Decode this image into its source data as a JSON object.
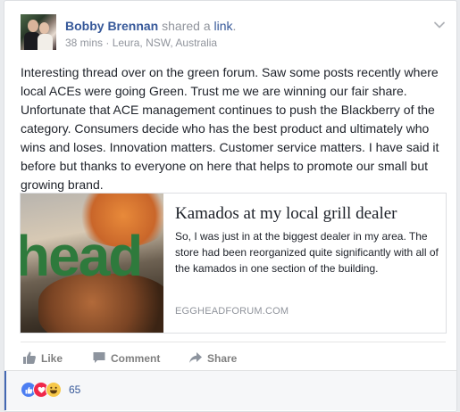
{
  "post": {
    "author": "Bobby Brennan",
    "action_text": " shared a ",
    "action_link": "link",
    "action_end": ".",
    "time": "38 mins",
    "separator": " · ",
    "location": "Leura, NSW, Australia",
    "body": "Interesting thread over on the green forum. Saw some posts recently where local ACEs were going Green. Trust me we are winning our fair share. Unfortunate that ACE management continues to push the Blackberry of the category. Consumers decide who has the best product and ultimately who wins and loses. Innovation matters. Customer service matters. I have said it before but thanks to everyone on here that helps to promote our small but growing brand."
  },
  "link_preview": {
    "image_text": "head",
    "title": "Kamados at my local grill dealer",
    "description": "So, I was just in at the biggest dealer in my area. The store had been reorganized quite significantly with all of the kamados in one section of the building.",
    "domain": "EGGHEADFORUM.COM"
  },
  "actions": {
    "like": "Like",
    "comment": "Comment",
    "share": "Share"
  },
  "reactions": {
    "count": "65",
    "types": [
      "like-icon",
      "love-icon",
      "haha-icon"
    ]
  },
  "colors": {
    "link_blue": "#365899",
    "meta_gray": "#90949c",
    "like_blue": "#4c7ef2",
    "love_red": "#f0284a",
    "haha_yellow": "#f7c84a"
  }
}
